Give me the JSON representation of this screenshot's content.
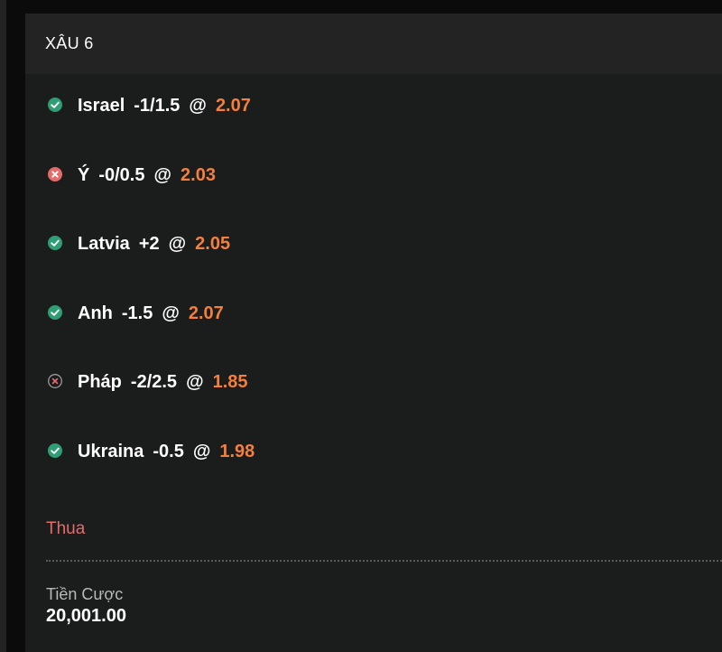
{
  "card": {
    "title": "XÂU 6"
  },
  "bets": [
    {
      "status": "won",
      "status_icon": "check-circle-icon",
      "team": "Israel",
      "handicap": "-1/1.5",
      "at": "@",
      "odds": "2.07"
    },
    {
      "status": "lost",
      "status_icon": "x-circle-icon",
      "team": "Ý",
      "handicap": "-0/0.5",
      "at": "@",
      "odds": "2.03"
    },
    {
      "status": "won",
      "status_icon": "check-circle-icon",
      "team": "Latvia",
      "handicap": "+2",
      "at": "@",
      "odds": "2.05"
    },
    {
      "status": "won",
      "status_icon": "check-circle-icon",
      "team": "Anh",
      "handicap": "-1.5",
      "at": "@",
      "odds": "2.07"
    },
    {
      "status": "half-lost",
      "status_icon": "x-circle-outline-icon",
      "team": "Pháp",
      "handicap": "-2/2.5",
      "at": "@",
      "odds": "1.85"
    },
    {
      "status": "won",
      "status_icon": "check-circle-icon",
      "team": "Ukraina",
      "handicap": "-0.5",
      "at": "@",
      "odds": "1.98"
    }
  ],
  "result": {
    "label": "Thua"
  },
  "stake": {
    "label": "Tiền Cược",
    "value": "20,001.00"
  },
  "colors": {
    "win": "#2f9e75",
    "loss": "#e66a6a",
    "odds": "#f47f3e",
    "card_bg": "#1b1c1c",
    "header_bg": "#232323"
  }
}
